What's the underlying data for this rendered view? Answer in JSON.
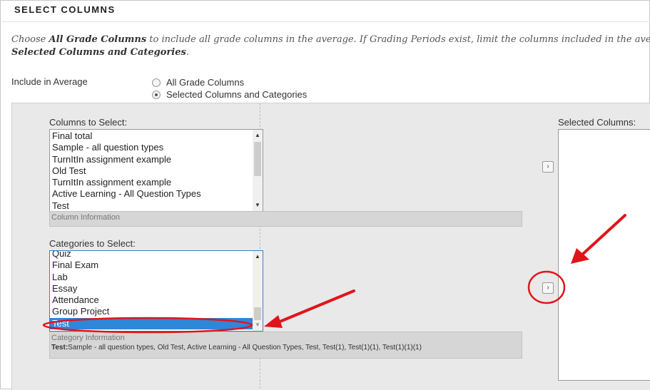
{
  "header": {
    "title": "SELECT COLUMNS"
  },
  "instructions": {
    "part1": "Choose ",
    "bold1": "All Grade Columns",
    "part2": " to include all grade columns in the average. If Grading Periods exist, limit the columns included in the average by choo",
    "bold2": "Selected Columns and Categories",
    "part3": "."
  },
  "include": {
    "label": "Include in Average",
    "options": [
      {
        "label": "All Grade Columns",
        "checked": false
      },
      {
        "label": "Selected Columns and Categories",
        "checked": true
      }
    ]
  },
  "columns": {
    "label": "Columns to Select:",
    "items": [
      "Final total",
      "Sample - all question types",
      "TurnItIn assignment example",
      "Old Test",
      "TurnItIn assignment example",
      "Active Learning - All Question Types",
      "Test"
    ],
    "info_title": "Column Information"
  },
  "categories": {
    "label": "Categories to Select:",
    "items": [
      "Quiz",
      "Final Exam",
      "Lab",
      "Essay",
      "Attendance",
      "Group Project",
      "Test"
    ],
    "selected_index": 6,
    "info_title": "Category Information",
    "info_key": "Test:",
    "info_detail": "Sample - all question types, Old Test, Active Learning - All Question Types, Test, Test(1), Test(1)(1), Test(1)(1)(1)"
  },
  "selected_columns": {
    "label": "Selected Columns:"
  },
  "buttons": {
    "move_glyph": "›"
  },
  "colors": {
    "annotation": "#e0151b",
    "selection": "#2f87d8"
  }
}
